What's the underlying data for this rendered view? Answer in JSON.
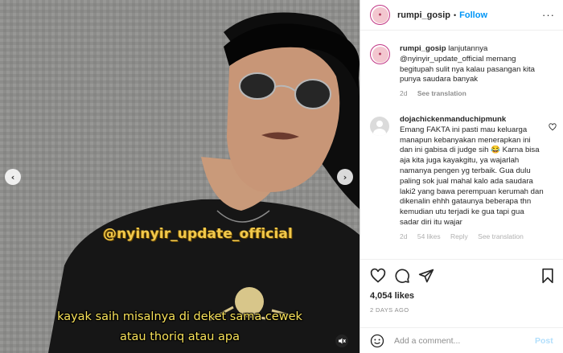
{
  "media": {
    "watermark": "@nyinyir_update_official",
    "subtitle_line1": "kayak saih misalnya di deket sama cewek",
    "subtitle_line2": "atau thoriq atau apa",
    "prev_icon": "chevron-left-icon",
    "next_icon": "chevron-right-icon",
    "mute_icon": "speaker-muted-icon"
  },
  "header": {
    "username": "rumpi_gosip",
    "separator": "•",
    "follow_label": "Follow",
    "more_label": "···"
  },
  "caption": {
    "username": "rumpi_gosip",
    "text": "lanjutannya @nyinyir_update_official memang begitupah sulit nya kalau pasangan kita punya saudara banyak",
    "time": "2d",
    "translate": "See translation"
  },
  "comment": {
    "username": "dojachickenmanduchipmunk",
    "text": "Emang FAKTA ini pasti mau keluarga manapun kebanyakan menerapkan ini dan ini gabisa di judge sih 😂 Karna bisa aja kita juga kayakgitu, ya wajarlah namanya pengen yg terbaik. Gua dulu paling sok jual mahal kalo ada saudara laki2 yang bawa perempuan kerumah dan dikenalin ehhh gataunya beberapa thn kemudian utu terjadi ke gua tapi gua sadar diri itu wajar",
    "time": "2d",
    "likes": "54 likes",
    "reply": "Reply",
    "translate": "See translation"
  },
  "actions": {
    "likes": "4,054 likes",
    "date": "2 DAYS AGO",
    "add_placeholder": "Add a comment...",
    "post_label": "Post"
  },
  "colors": {
    "accent": "#0095f6",
    "post_disabled": "#b2dffc",
    "subtitle": "#f7e15a",
    "watermark": "#f2c94c"
  }
}
